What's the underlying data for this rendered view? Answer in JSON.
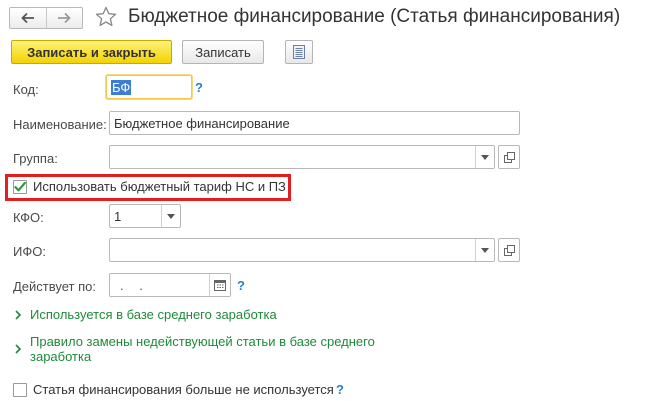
{
  "header": {
    "back_icon": "arrow-left-icon",
    "forward_icon": "arrow-right-icon",
    "favorite_icon": "star-icon",
    "title": "Бюджетное финансирование (Статья финансирования)"
  },
  "toolbar": {
    "save_close_label": "Записать и закрыть",
    "save_label": "Записать",
    "list_icon": "list-icon"
  },
  "form": {
    "code": {
      "label": "Код:",
      "value": "БФ",
      "help": "?"
    },
    "name": {
      "label": "Наименование:",
      "value": "Бюджетное финансирование"
    },
    "group": {
      "label": "Группа:",
      "value": ""
    },
    "budget_tariff": {
      "label": "Использовать бюджетный тариф НС и ПЗ",
      "checked": true
    },
    "kfo": {
      "label": "КФО:",
      "value": "1"
    },
    "ifo": {
      "label": "ИФО:",
      "value": ""
    },
    "valid_until": {
      "label": "Действует по:",
      "value": ". .",
      "help": "?"
    }
  },
  "links": {
    "used_in_avg": "Используется в базе среднего заработка",
    "replace_rule_line1": "Правило замены недействующей статьи в базе среднего",
    "replace_rule_line2": "заработка"
  },
  "footer": {
    "not_used_label": "Статья финансирования больше не используется",
    "not_used_checked": false,
    "help": "?"
  },
  "colors": {
    "primary_button": "#f2d200",
    "focus_border": "#f2c84b",
    "link_green": "#1f8a3a",
    "help_blue": "#2f7bd2",
    "highlight_red": "#e02020",
    "check_green": "#2e9a3e"
  }
}
